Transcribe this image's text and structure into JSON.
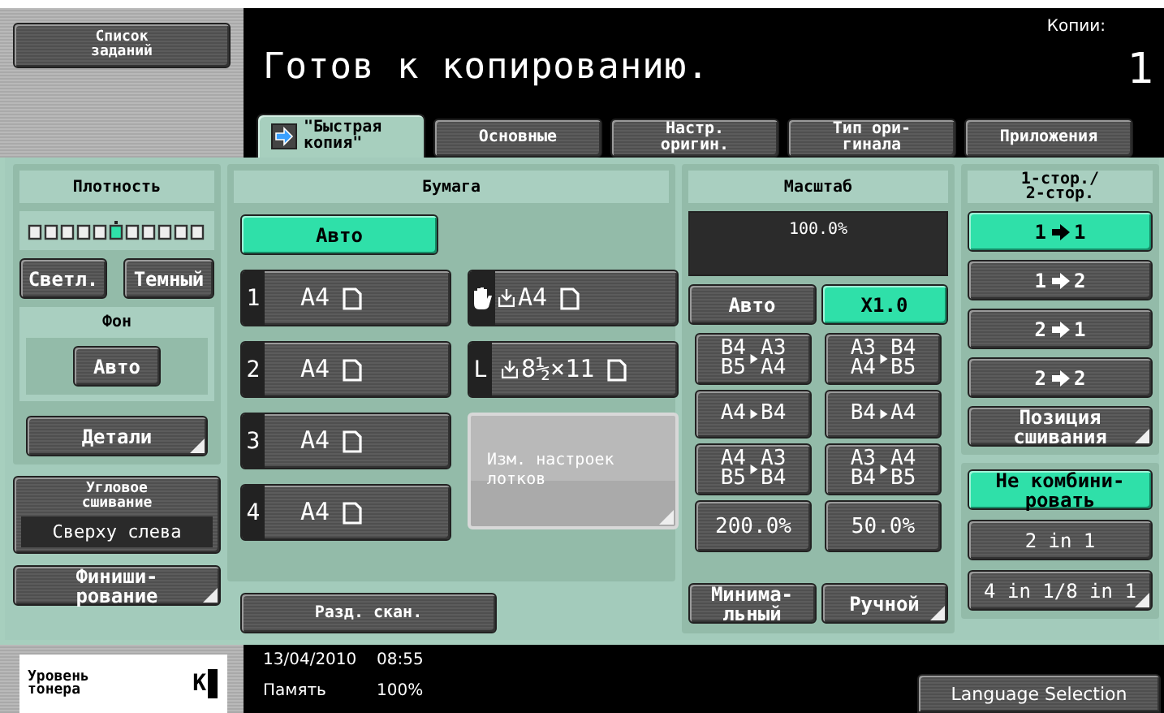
{
  "header": {
    "job_list_button": "Список\nзаданий",
    "title": "Готов к копированию.",
    "copies_label": "Копии:",
    "copies_value": "1"
  },
  "tabs": [
    {
      "label": "\"Быстрая\nкопия\"",
      "kind": "icon",
      "selected": true
    },
    {
      "label": "Основные",
      "kind": "plain",
      "selected": false
    },
    {
      "label": "Настр.\nоригин.",
      "kind": "plain",
      "selected": false
    },
    {
      "label": "Тип ори-\nгинала",
      "kind": "plain",
      "selected": false
    },
    {
      "label": "Приложения",
      "kind": "plain",
      "selected": false
    }
  ],
  "density": {
    "title": "Плотность",
    "scale": {
      "level": 0.5
    },
    "lighter_button": "Светл.",
    "darker_button": "Темный",
    "background": {
      "title": "Фон",
      "button": "Авто"
    },
    "details_button": {
      "label": "Детали",
      "submenu": true
    },
    "stapling": {
      "title": "Угловое\nсшивание",
      "value": "Сверху слева"
    },
    "finishing_button": {
      "label": "Финиши-\nрование",
      "submenu": true
    }
  },
  "paper": {
    "title": "Бумага",
    "auto": {
      "label": "Авто",
      "selected": true
    },
    "trays": [
      {
        "kind": "cassette",
        "marker": "1",
        "size": "A4"
      },
      {
        "kind": "bypass",
        "size": "A4"
      },
      {
        "kind": "cassette",
        "marker": "2",
        "size": "A4"
      },
      {
        "kind": "lct",
        "marker": "L",
        "size": "8½×11"
      },
      {
        "kind": "cassette",
        "marker": "3",
        "size": "A4"
      },
      {
        "kind": "cassette",
        "marker": "4",
        "size": "A4"
      }
    ],
    "tray_settings_button": {
      "label": "Изм. настроек\nлотков",
      "submenu": true
    },
    "separate_scan_button": "Разд. скан."
  },
  "zoom": {
    "title": "Масштаб",
    "display": "100.0%",
    "modes": [
      {
        "label": "Авто",
        "selected": false
      },
      {
        "label": "X1.0",
        "selected": true
      }
    ],
    "presets": [
      {
        "kind": "ratio",
        "from": [
          "B4",
          "B5"
        ],
        "to": [
          "A3",
          "A4"
        ]
      },
      {
        "kind": "ratio",
        "from": [
          "A3",
          "A4"
        ],
        "to": [
          "B4",
          "B5"
        ]
      },
      {
        "kind": "ratio",
        "from": [
          "A4"
        ],
        "to": [
          "B4"
        ]
      },
      {
        "kind": "ratio",
        "from": [
          "B4"
        ],
        "to": [
          "A4"
        ]
      },
      {
        "kind": "ratio",
        "from": [
          "A4",
          "B5"
        ],
        "to": [
          "A3",
          "B4"
        ]
      },
      {
        "kind": "ratio",
        "from": [
          "A3",
          "B4"
        ],
        "to": [
          "A4",
          "B5"
        ]
      },
      {
        "kind": "percent",
        "label": "200.0%"
      },
      {
        "kind": "percent",
        "label": "50.0%"
      }
    ],
    "minimal_button": {
      "label": "Минима-\nльный",
      "submenu": false
    },
    "manual_button": {
      "label": "Ручной",
      "submenu": true
    }
  },
  "duplex": {
    "title": "1-стор./\n2-стор.",
    "modes": [
      {
        "from": "1",
        "to": "1",
        "selected": true
      },
      {
        "from": "1",
        "to": "2",
        "selected": false
      },
      {
        "from": "2",
        "to": "1",
        "selected": false
      },
      {
        "from": "2",
        "to": "2",
        "selected": false
      }
    ],
    "staple_position_button": {
      "label": "Позиция\nсшивания",
      "submenu": true
    },
    "combine": [
      {
        "label": "Не комбини-\nровать",
        "selected": true,
        "submenu": false
      },
      {
        "label": "2 in 1",
        "selected": false,
        "submenu": false
      },
      {
        "label": "4 in 1/8 in 1",
        "selected": false,
        "submenu": true
      }
    ]
  },
  "footer": {
    "toner_label": "Уровень\nтонера",
    "toner_color": "K",
    "date": "13/04/2010",
    "time": "08:55",
    "memory_label": "Память",
    "memory_value": "100%",
    "language_button": "Language Selection"
  }
}
